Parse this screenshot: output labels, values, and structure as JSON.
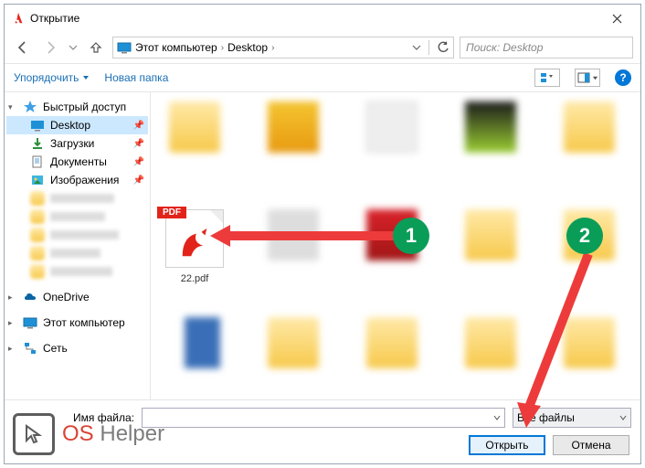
{
  "title": "Открытие",
  "nav": {
    "crumb1": "Этот компьютер",
    "crumb2": "Desktop",
    "search_placeholder": "Поиск: Desktop"
  },
  "toolbar": {
    "organize": "Упорядочить",
    "newfolder": "Новая папка"
  },
  "sidebar": {
    "quick": "Быстрый доступ",
    "desktop": "Desktop",
    "downloads": "Загрузки",
    "documents": "Документы",
    "pictures": "Изображения",
    "onedrive": "OneDrive",
    "thispc": "Этот компьютер",
    "network": "Сеть"
  },
  "content": {
    "pdf_badge": "PDF",
    "pdf_label": "22.pdf"
  },
  "footer": {
    "filename_label": "Имя файла:",
    "filter": "Все файлы",
    "open": "Открыть",
    "cancel": "Отмена"
  },
  "annotations": {
    "one": "1",
    "two": "2"
  },
  "watermark": {
    "os": "OS",
    "helper": " Helper"
  }
}
